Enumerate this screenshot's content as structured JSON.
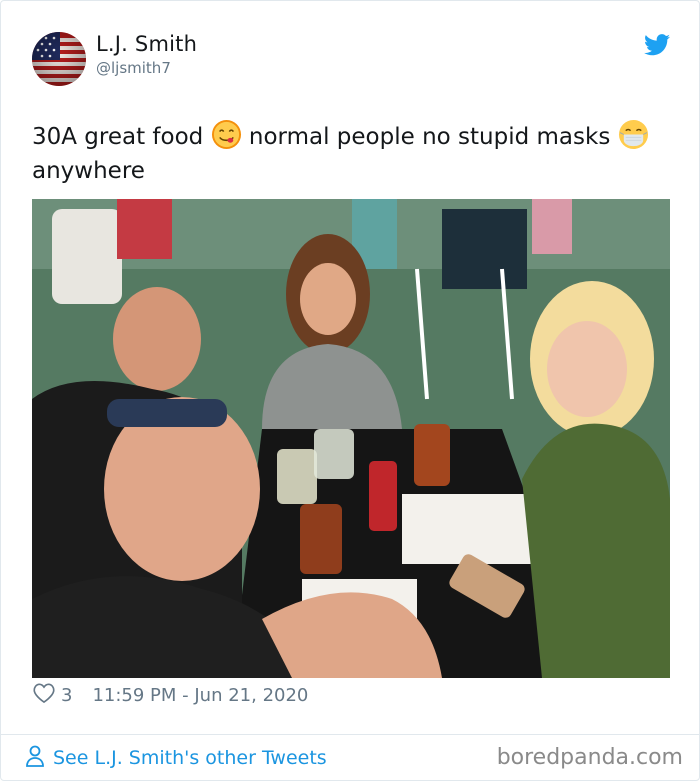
{
  "tweet": {
    "display_name": "L.J. Smith",
    "handle": "@ljsmith7",
    "text_part1": "30A great food",
    "text_part2": "normal people no stupid masks",
    "text_part3": "anywhere",
    "emojis": [
      "face-savoring-food-icon",
      "face-with-medical-mask-icon"
    ],
    "photo_description_icon": "photo-of-four-people-at-restaurant-table",
    "likes": "3",
    "timestamp": "11:59 PM - Jun 21, 2020",
    "footer_link": "See L.J. Smith's other Tweets"
  },
  "watermark": "boredpanda.com",
  "colors": {
    "link": "#1b95e0",
    "secondary_text": "#657786",
    "twitter_blue": "#1da1f2"
  }
}
